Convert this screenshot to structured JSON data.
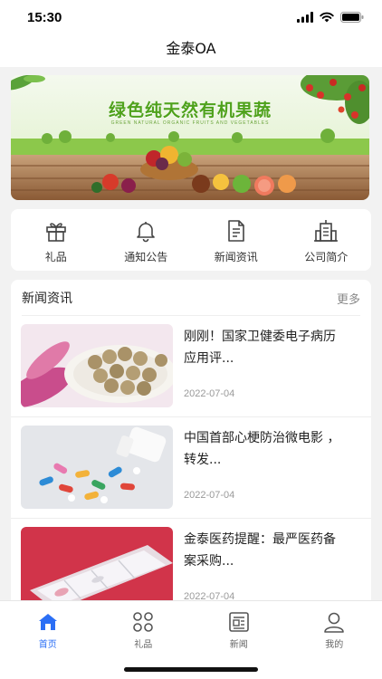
{
  "status": {
    "time": "15:30"
  },
  "header": {
    "title": "金泰OA"
  },
  "banner": {
    "headline": "绿色纯天然有机果蔬",
    "subline": "GREEN NATURAL ORGANIC FRUITS AND VEGETABLES"
  },
  "quick_menu": [
    {
      "label": "礼品",
      "icon": "gift-icon"
    },
    {
      "label": "通知公告",
      "icon": "bell-icon"
    },
    {
      "label": "新闻资讯",
      "icon": "document-icon"
    },
    {
      "label": "公司简介",
      "icon": "building-icon"
    }
  ],
  "news": {
    "section_title": "新闻资讯",
    "more_label": "更多",
    "items": [
      {
        "title": "刚刚！国家卫健委电子病历应用评...",
        "date": "2022-07-04"
      },
      {
        "title": "中国首部心梗防治微电影 ，转发...",
        "date": "2022-07-04"
      },
      {
        "title": "金泰医药提醒：最严医药备案采购...",
        "date": "2022-07-04"
      }
    ]
  },
  "tabs": [
    {
      "label": "首页",
      "icon": "home-icon",
      "active": true
    },
    {
      "label": "礼品",
      "icon": "grid-icon",
      "active": false
    },
    {
      "label": "新闻",
      "icon": "newspaper-icon",
      "active": false
    },
    {
      "label": "我的",
      "icon": "user-icon",
      "active": false
    }
  ],
  "colors": {
    "accent": "#2b6ff5",
    "banner_green": "#4fa21c"
  }
}
